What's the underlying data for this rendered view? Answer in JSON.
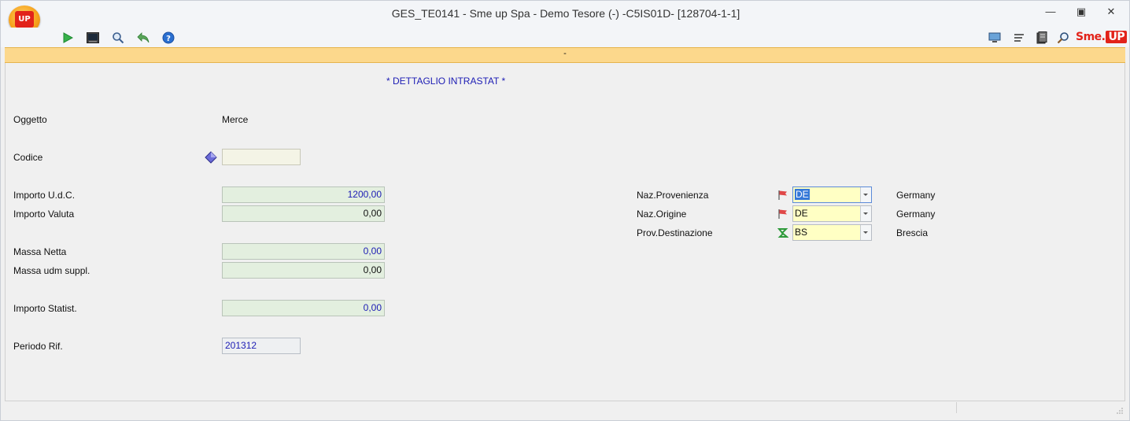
{
  "window": {
    "title": "GES_TE0141 - Sme up Spa  - Demo Tesore (-) -C5IS01D- [128704-1-1]",
    "app_logo_text": "UP",
    "controls": {
      "minimize": "—",
      "restore": "▣",
      "close": "✕"
    }
  },
  "toolbar": {
    "left_icons": [
      "play-icon",
      "terminal-icon",
      "zoom-icon",
      "undo-icon",
      "help-icon"
    ],
    "right_icons": [
      "monitor-icon",
      "list-icon",
      "document-icon",
      "search-icon"
    ],
    "brand_text": "Sme.",
    "brand_badge": "UP"
  },
  "banner": {
    "text": "-"
  },
  "section": {
    "title": "* DETTAGLIO INTRASTAT *"
  },
  "fields": {
    "oggetto_label": "Oggetto",
    "oggetto_value": "Merce",
    "codice_label": "Codice",
    "codice_value": "",
    "importo_udc_label": "Importo U.d.C.",
    "importo_udc_value": "1200,00",
    "importo_valuta_label": "Importo Valuta",
    "importo_valuta_value": "0,00",
    "massa_netta_label": "Massa Netta",
    "massa_netta_value": "0,00",
    "massa_udm_label": "Massa udm suppl.",
    "massa_udm_value": "0,00",
    "importo_statist_label": "Importo Statist.",
    "importo_statist_value": "0,00",
    "periodo_label": "Periodo Rif.",
    "periodo_value": "201312"
  },
  "right_fields": {
    "provenienza_label": "Naz.Provenienza",
    "provenienza_value": "DE",
    "provenienza_desc": "Germany",
    "origine_label": "Naz.Origine",
    "origine_value": "DE",
    "origine_desc": "Germany",
    "destinazione_label": "Prov.Destinazione",
    "destinazione_value": "BS",
    "destinazione_desc": "Brescia"
  },
  "colors": {
    "banner": "#fcd88c",
    "field_blue_text": "#1c1cb4",
    "combo_bg": "#ffffc4",
    "brand_red": "#e2231a"
  }
}
